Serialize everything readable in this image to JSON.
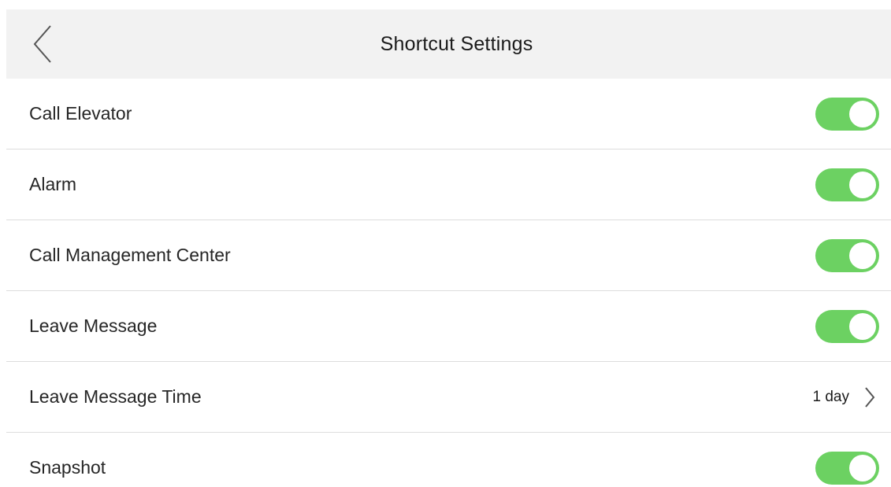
{
  "header": {
    "title": "Shortcut Settings",
    "back_icon": "chevron-left-icon"
  },
  "colors": {
    "toggle_on": "#6cd162",
    "header_bg": "#f2f2f2",
    "divider": "#dddddd"
  },
  "rows": [
    {
      "label": "Call Elevator",
      "control": "toggle",
      "enabled": true
    },
    {
      "label": "Alarm",
      "control": "toggle",
      "enabled": true
    },
    {
      "label": "Call Management Center",
      "control": "toggle",
      "enabled": true
    },
    {
      "label": "Leave Message",
      "control": "toggle",
      "enabled": true
    },
    {
      "label": "Leave Message Time",
      "control": "select",
      "value": "1 day",
      "icon": "chevron-right-icon"
    },
    {
      "label": "Snapshot",
      "control": "toggle",
      "enabled": true
    }
  ]
}
